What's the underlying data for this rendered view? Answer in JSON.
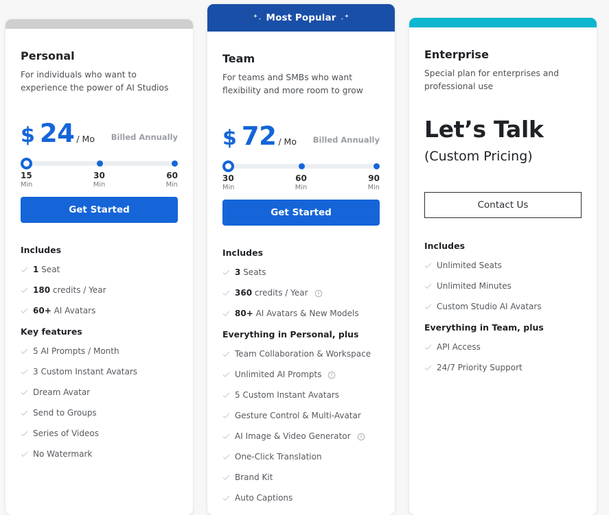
{
  "colors": {
    "brand_blue": "#1565d8",
    "banner_blue": "#1a4fa8",
    "enterprise_cyan": "#0bb6ce",
    "personal_gray": "#cfcfd1",
    "page_background": "#f7f7f8"
  },
  "plans": [
    {
      "id": "personal",
      "cap_type": "gray-bar",
      "name": "Personal",
      "description": "For individuals who want to experience the power of AI Studios",
      "currency": "$",
      "amount": "24",
      "period": "/ Mo",
      "billing_note": "Billed Annually",
      "slider": {
        "selected_index": 0,
        "ticks": [
          {
            "value": "15",
            "unit": "Min"
          },
          {
            "value": "30",
            "unit": "Min"
          },
          {
            "value": "60",
            "unit": "Min"
          }
        ]
      },
      "cta_label": "Get Started",
      "cta_style": "filled",
      "groups": [
        {
          "title": "Includes",
          "items": [
            {
              "strong": "1",
              "text": "Seat"
            },
            {
              "strong": "180",
              "text": "credits / Year"
            },
            {
              "strong": "60+",
              "text": "AI Avatars"
            }
          ]
        },
        {
          "title": "Key features",
          "items": [
            {
              "strong": "",
              "text": "5 AI Prompts / Month"
            },
            {
              "strong": "",
              "text": "3 Custom Instant Avatars"
            },
            {
              "strong": "",
              "text": "Dream Avatar"
            },
            {
              "strong": "",
              "text": "Send to Groups"
            },
            {
              "strong": "",
              "text": "Series of Videos"
            },
            {
              "strong": "",
              "text": "No Watermark"
            }
          ]
        }
      ]
    },
    {
      "id": "team",
      "cap_type": "banner",
      "banner_label": "Most Popular",
      "name": "Team",
      "description": "For teams and SMBs who want flexibility and more room to grow",
      "currency": "$",
      "amount": "72",
      "period": "/ Mo",
      "billing_note": "Billed Annually",
      "slider": {
        "selected_index": 0,
        "ticks": [
          {
            "value": "30",
            "unit": "Min"
          },
          {
            "value": "60",
            "unit": "Min"
          },
          {
            "value": "90",
            "unit": "Min"
          }
        ]
      },
      "cta_label": "Get Started",
      "cta_style": "filled",
      "groups": [
        {
          "title": "Includes",
          "items": [
            {
              "strong": "3",
              "text": "Seats"
            },
            {
              "strong": "360",
              "text": "credits / Year",
              "info": true
            },
            {
              "strong": "80+",
              "text": "AI Avatars & New Models"
            }
          ]
        },
        {
          "title": "Everything in Personal, plus",
          "items": [
            {
              "strong": "",
              "text": "Team Collaboration & Workspace"
            },
            {
              "strong": "",
              "text": "Unlimited AI Prompts",
              "info": true
            },
            {
              "strong": "",
              "text": "5 Custom Instant Avatars"
            },
            {
              "strong": "",
              "text": "Gesture Control & Multi-Avatar"
            },
            {
              "strong": "",
              "text": "AI Image & Video Generator",
              "info": true
            },
            {
              "strong": "",
              "text": "One-Click Translation"
            },
            {
              "strong": "",
              "text": "Brand Kit"
            },
            {
              "strong": "",
              "text": "Auto Captions"
            }
          ]
        }
      ]
    },
    {
      "id": "enterprise",
      "cap_type": "cyan-bar",
      "name": "Enterprise",
      "description": "Special plan for enterprises and professional use",
      "headline": "Let’s Talk",
      "subheadline": "(Custom Pricing)",
      "cta_label": "Contact Us",
      "cta_style": "outline",
      "groups": [
        {
          "title": "Includes",
          "items": [
            {
              "strong": "",
              "text": "Unlimited Seats"
            },
            {
              "strong": "",
              "text": "Unlimited Minutes"
            },
            {
              "strong": "",
              "text": "Custom Studio AI Avatars"
            }
          ]
        },
        {
          "title": "Everything in Team, plus",
          "items": [
            {
              "strong": "",
              "text": "API Access"
            },
            {
              "strong": "",
              "text": "24/7 Priority Support"
            }
          ]
        }
      ]
    }
  ]
}
